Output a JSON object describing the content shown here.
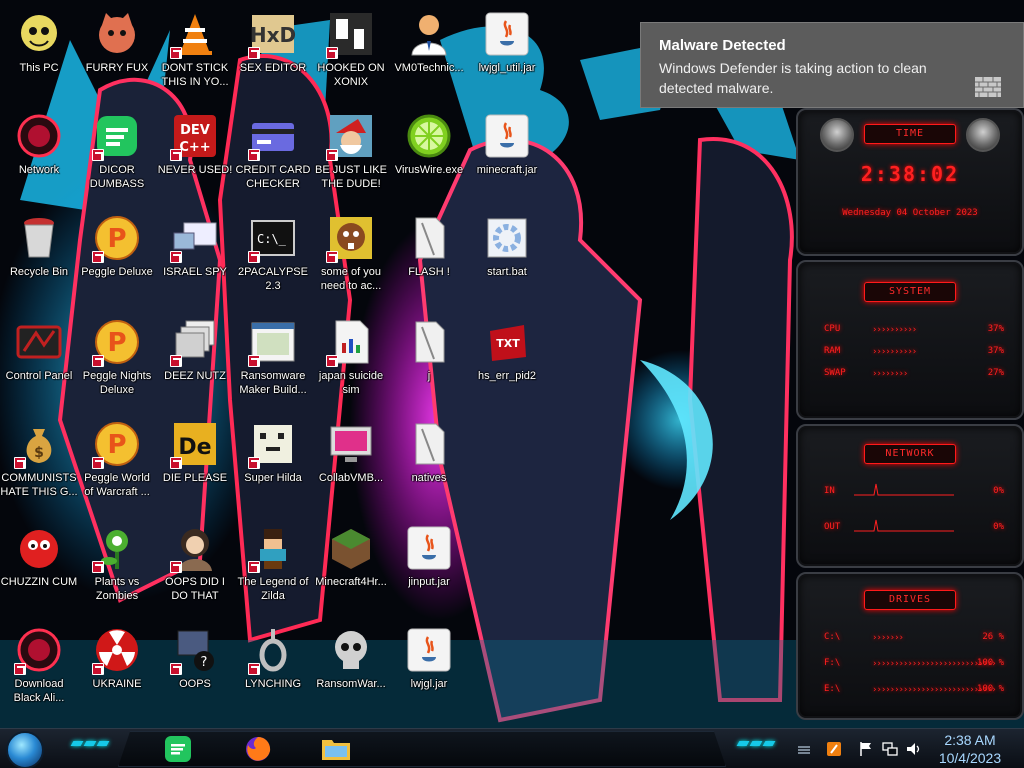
{
  "desktop": {
    "icons": [
      {
        "id": "this-pc",
        "label": "This PC",
        "col": 0,
        "row": 0,
        "shortcut": false,
        "icon": "cartoon-icon",
        "color": "#e8d860"
      },
      {
        "id": "network",
        "label": "Network",
        "col": 0,
        "row": 1,
        "shortcut": false,
        "icon": "alienware-orb-icon",
        "color": "#b01030"
      },
      {
        "id": "recycle-bin",
        "label": "Recycle Bin",
        "col": 0,
        "row": 2,
        "shortcut": false,
        "icon": "bin-icon",
        "color": "#c43030"
      },
      {
        "id": "control-panel",
        "label": "Control Panel",
        "col": 0,
        "row": 3,
        "shortcut": false,
        "icon": "panel-icon",
        "color": "#c02020"
      },
      {
        "id": "communists",
        "label": "COMMUNISTS HATE THIS G...",
        "col": 0,
        "row": 4,
        "shortcut": true,
        "icon": "money-bag-icon",
        "color": "#d9a441"
      },
      {
        "id": "chuzzin",
        "label": "CHUZZIN CUM",
        "col": 0,
        "row": 5,
        "shortcut": false,
        "icon": "chuzzle-icon",
        "color": "#e02020"
      },
      {
        "id": "download-black-ali",
        "label": "Download Black Ali...",
        "col": 0,
        "row": 6,
        "shortcut": true,
        "icon": "alienware-orb-icon",
        "color": "#b01030"
      },
      {
        "id": "furry-fux",
        "label": "FURRY FUX",
        "col": 1,
        "row": 0,
        "shortcut": false,
        "icon": "furry-icon",
        "color": "#e07050"
      },
      {
        "id": "dicor-dumbass",
        "label": "DICOR DUMBASS",
        "col": 1,
        "row": 1,
        "shortcut": true,
        "icon": "spotify-like-icon",
        "color": "#22c55e"
      },
      {
        "id": "peggle-deluxe",
        "label": "Peggle Deluxe",
        "col": 1,
        "row": 2,
        "shortcut": true,
        "icon": "peggle-icon",
        "color": "#e8541a"
      },
      {
        "id": "peggle-nights",
        "label": "Peggle Nights Deluxe",
        "col": 1,
        "row": 3,
        "shortcut": true,
        "icon": "peggle-icon",
        "color": "#e8541a"
      },
      {
        "id": "peggle-world",
        "label": "Peggle World of Warcraft ...",
        "col": 1,
        "row": 4,
        "shortcut": true,
        "icon": "peggle-icon",
        "color": "#e8541a"
      },
      {
        "id": "plants-vs-zombies",
        "label": "Plants vs Zombies",
        "col": 1,
        "row": 5,
        "shortcut": true,
        "icon": "plant-icon",
        "color": "#4caf30"
      },
      {
        "id": "ukraine",
        "label": "UKRAINE",
        "col": 1,
        "row": 6,
        "shortcut": true,
        "icon": "radiation-icon",
        "color": "#d01818"
      },
      {
        "id": "dont-stick",
        "label": "DONT STICK THIS IN YO...",
        "col": 2,
        "row": 0,
        "shortcut": true,
        "icon": "vlc-cone-icon",
        "color": "#f08010"
      },
      {
        "id": "never-used",
        "label": "NEVER USED!",
        "col": 2,
        "row": 1,
        "shortcut": true,
        "icon": "devcpp-icon",
        "color": "#c41a1a"
      },
      {
        "id": "israel-spy",
        "label": "ISRAEL SPY",
        "col": 2,
        "row": 2,
        "shortcut": true,
        "icon": "remote-pc-icon",
        "color": "#9ab8d8"
      },
      {
        "id": "deez-nutz",
        "label": "DEEZ NUTZ",
        "col": 2,
        "row": 3,
        "shortcut": true,
        "icon": "windows-stack-icon",
        "color": "#d0d0d0"
      },
      {
        "id": "die-please",
        "label": "DIE PLEASE",
        "col": 2,
        "row": 4,
        "shortcut": true,
        "icon": "de-icon",
        "color": "#e8b020"
      },
      {
        "id": "oops-did-i",
        "label": "OOPS DID I DO THAT",
        "col": 2,
        "row": 5,
        "shortcut": true,
        "icon": "portrait-icon",
        "color": "#8a6a50"
      },
      {
        "id": "oops",
        "label": "OOPS",
        "col": 2,
        "row": 6,
        "shortcut": true,
        "icon": "network-trouble-icon",
        "color": "#4a5a80"
      },
      {
        "id": "sex-editor",
        "label": "SEX EDITOR",
        "col": 3,
        "row": 0,
        "shortcut": true,
        "icon": "hxd-icon",
        "color": "#e0c890"
      },
      {
        "id": "credit-card-checker",
        "label": "CREDIT CARD CHECKER",
        "col": 3,
        "row": 1,
        "shortcut": true,
        "icon": "credit-card-icon",
        "color": "#6a6ae0"
      },
      {
        "id": "2pacalypse",
        "label": "2PACALYPSE 2.3",
        "col": 3,
        "row": 2,
        "shortcut": true,
        "icon": "terminal-icon",
        "color": "#1a1a1a"
      },
      {
        "id": "ransomware-maker",
        "label": "Ransomware Maker Build...",
        "col": 3,
        "row": 3,
        "shortcut": true,
        "icon": "app-window-icon",
        "color": "#d0e0c0"
      },
      {
        "id": "super-hilda",
        "label": "Super Hilda",
        "col": 3,
        "row": 4,
        "shortcut": true,
        "icon": "pixel-cat-icon",
        "color": "#f0f0e0"
      },
      {
        "id": "legend-of-zilda",
        "label": "The Legend of Zilda",
        "col": 3,
        "row": 5,
        "shortcut": true,
        "icon": "pixel-hero-icon",
        "color": "#30a0c0"
      },
      {
        "id": "lynching",
        "label": "LYNCHING",
        "col": 3,
        "row": 6,
        "shortcut": true,
        "icon": "noose-icon",
        "color": "#c0c0c0"
      },
      {
        "id": "hooked-on-xonix",
        "label": "HOOKED ON XONIX",
        "col": 4,
        "row": 0,
        "shortcut": true,
        "icon": "xonix-icon",
        "color": "#2a2a2a"
      },
      {
        "id": "be-just-like",
        "label": "BE JUST LIKE THE DUDE!",
        "col": 4,
        "row": 1,
        "shortcut": true,
        "icon": "santa-icon",
        "color": "#60a0c0"
      },
      {
        "id": "some-of-you",
        "label": "some of you need to ac...",
        "col": 4,
        "row": 2,
        "shortcut": true,
        "icon": "beaver-icon",
        "color": "#e0c030"
      },
      {
        "id": "japan-suicide-sim",
        "label": "japan suicide sim",
        "col": 4,
        "row": 3,
        "shortcut": true,
        "icon": "document-icon",
        "color": "#f4f4f4"
      },
      {
        "id": "collabvmb",
        "label": "CollabVMB...",
        "col": 4,
        "row": 4,
        "shortcut": false,
        "icon": "monitor-icon",
        "color": "#e0308a"
      },
      {
        "id": "minecraft4hr",
        "label": "Minecraft4Hr...",
        "col": 4,
        "row": 5,
        "shortcut": false,
        "icon": "grass-block-icon",
        "color": "#4a8a30"
      },
      {
        "id": "ransomwar",
        "label": "RansomWar...",
        "col": 4,
        "row": 6,
        "shortcut": false,
        "icon": "skull-icon",
        "color": "#d0d0d0"
      },
      {
        "id": "vm0technic",
        "label": "VM0Technic...",
        "col": 5,
        "row": 0,
        "shortcut": false,
        "icon": "doctor-icon",
        "color": "#f0b070"
      },
      {
        "id": "viruswire",
        "label": "VirusWire.exe",
        "col": 5,
        "row": 1,
        "shortcut": false,
        "icon": "lime-icon",
        "color": "#80d020"
      },
      {
        "id": "flash",
        "label": "FLASH !",
        "col": 5,
        "row": 2,
        "shortcut": false,
        "icon": "file-doc-icon",
        "color": "#e8e8e8"
      },
      {
        "id": "j",
        "label": "j",
        "col": 5,
        "row": 3,
        "shortcut": false,
        "icon": "file-doc-icon",
        "color": "#e8e8e8"
      },
      {
        "id": "natives",
        "label": "natives",
        "col": 5,
        "row": 4,
        "shortcut": false,
        "icon": "file-doc-icon",
        "color": "#e8e8e8"
      },
      {
        "id": "jinput-jar",
        "label": "jinput.jar",
        "col": 5,
        "row": 5,
        "shortcut": false,
        "icon": "java-icon",
        "color": "#f4f4f4"
      },
      {
        "id": "lwjgl-jar",
        "label": "lwjgl.jar",
        "col": 5,
        "row": 6,
        "shortcut": false,
        "icon": "java-icon",
        "color": "#f4f4f4"
      },
      {
        "id": "lwjgl-util-jar",
        "label": "lwjgl_util.jar",
        "col": 6,
        "row": 0,
        "shortcut": false,
        "icon": "java-icon",
        "color": "#f4f4f4"
      },
      {
        "id": "minecraft-jar",
        "label": "minecraft.jar",
        "col": 6,
        "row": 1,
        "shortcut": false,
        "icon": "java-icon",
        "color": "#f4f4f4"
      },
      {
        "id": "start-bat",
        "label": "start.bat",
        "col": 6,
        "row": 2,
        "shortcut": false,
        "icon": "batch-gear-icon",
        "color": "#8ab0e0"
      },
      {
        "id": "hs-err-pid2",
        "label": "hs_err_pid2",
        "col": 6,
        "row": 3,
        "shortcut": false,
        "icon": "txt-file-icon",
        "color": "#c0101a"
      }
    ]
  },
  "toast": {
    "title": "Malware Detected",
    "body": "Windows Defender is taking action to clean detected malware.",
    "icon": "defender-wall-icon"
  },
  "gadget": {
    "time": {
      "title": "TIME",
      "clock": "2:38:02",
      "date": "Wednesday 04 October 2023"
    },
    "system": {
      "title": "SYSTEM",
      "rows": [
        {
          "name": "CPU",
          "value": "37%",
          "level": 0.37
        },
        {
          "name": "RAM",
          "value": "37%",
          "level": 0.37
        },
        {
          "name": "SWAP",
          "value": "27%",
          "level": 0.27
        }
      ]
    },
    "network": {
      "title": "NETWORK",
      "rows": [
        {
          "name": "IN",
          "value": "0%"
        },
        {
          "name": "OUT",
          "value": "0%"
        }
      ]
    },
    "drives": {
      "title": "DRIVES",
      "rows": [
        {
          "name": "C:\\",
          "value": "26 %",
          "level": 0.26
        },
        {
          "name": "F:\\",
          "value": "100 %",
          "level": 1.0
        },
        {
          "name": "E:\\",
          "value": "100 %",
          "level": 1.0
        }
      ]
    },
    "accent": "#ff2020"
  },
  "taskbar": {
    "apps": [
      {
        "id": "app-green",
        "icon": "spotify-like-icon",
        "color": "#22c55e"
      },
      {
        "id": "app-firefox",
        "icon": "firefox-icon",
        "color": "#ff7a18"
      },
      {
        "id": "app-explorer",
        "icon": "folder-icon",
        "color": "#f0c040"
      }
    ],
    "clock_time": "2:38 AM",
    "clock_date": "10/4/2023"
  }
}
